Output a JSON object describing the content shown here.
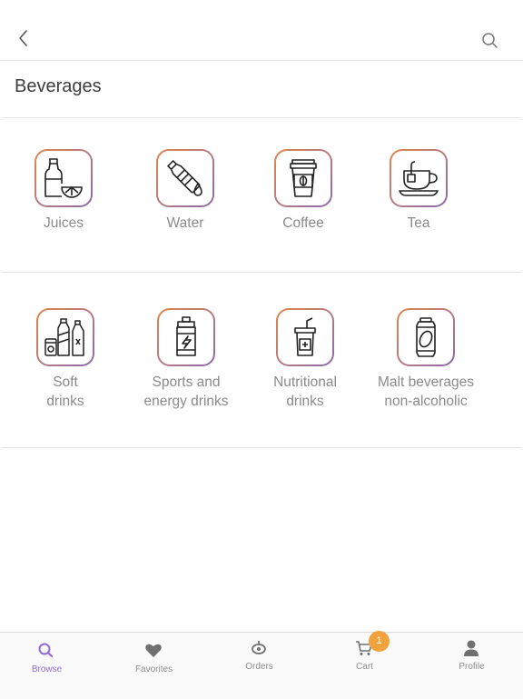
{
  "header": {
    "back_icon": "chevron-left-icon",
    "search_icon": "search-icon"
  },
  "page_title": "Beverages",
  "categories": [
    {
      "label": "Juices",
      "icon": "juice-icon"
    },
    {
      "label": "Water",
      "icon": "water-bottle-icon"
    },
    {
      "label": "Coffee",
      "icon": "coffee-cup-icon"
    },
    {
      "label": "Tea",
      "icon": "tea-cup-icon"
    },
    {
      "label": "Soft\ndrinks",
      "icon": "soft-drinks-icon"
    },
    {
      "label": "Sports and\nenergy drinks",
      "icon": "sports-bottle-icon"
    },
    {
      "label": "Nutritional\ndrinks",
      "icon": "nutritional-drink-icon"
    },
    {
      "label": "Malt beverages\nnon-alcoholic",
      "icon": "malt-can-icon"
    }
  ],
  "tabbar": {
    "active": "Browse",
    "accent_color": "#8e6cd9",
    "badge_color": "#f0a33c",
    "tabs": [
      {
        "label": "Browse",
        "icon": "search-icon"
      },
      {
        "label": "Favorites",
        "icon": "heart-icon"
      },
      {
        "label": "Orders",
        "icon": "orders-icon"
      },
      {
        "label": "Cart",
        "icon": "cart-icon",
        "badge": "1"
      },
      {
        "label": "Profile",
        "icon": "profile-icon"
      }
    ]
  }
}
